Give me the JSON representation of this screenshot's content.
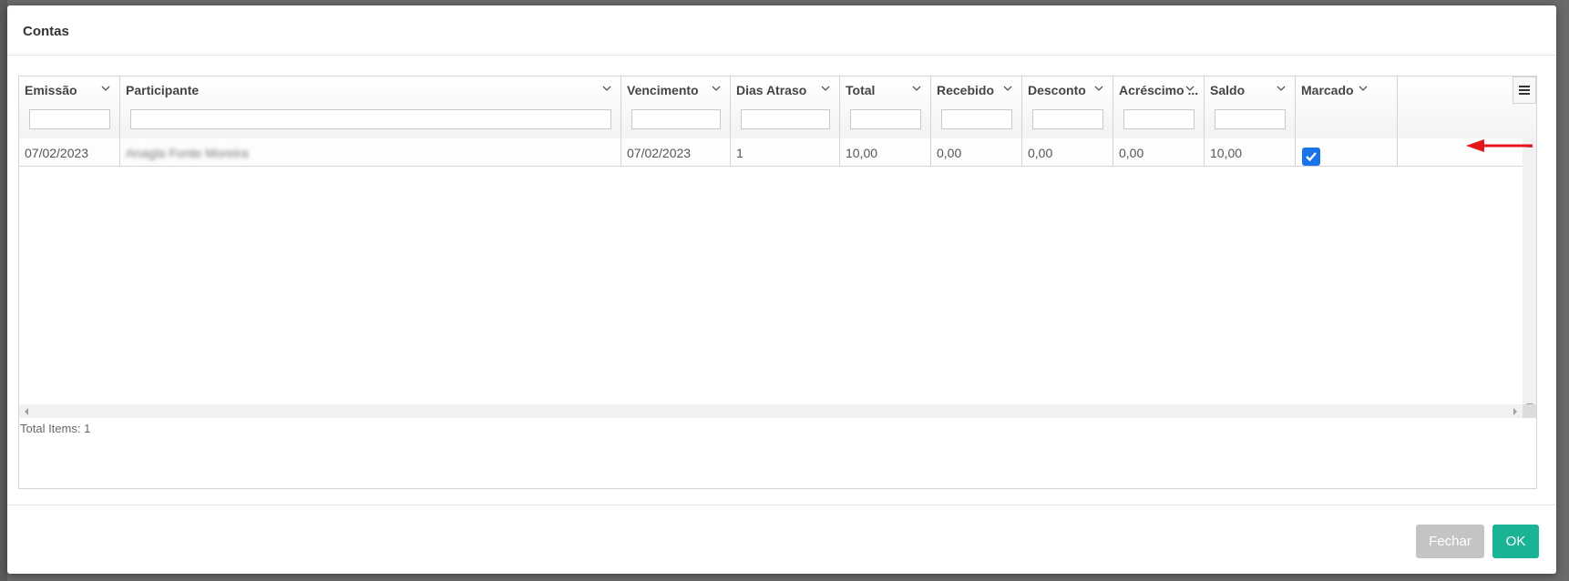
{
  "modal": {
    "title": "Contas"
  },
  "grid": {
    "columns": [
      {
        "key": "emissao",
        "label": "Emissão",
        "width": 111
      },
      {
        "key": "participante",
        "label": "Participante",
        "width": 550
      },
      {
        "key": "vencimento",
        "label": "Vencimento",
        "width": 120
      },
      {
        "key": "dias_atraso",
        "label": "Dias Atraso",
        "width": 120
      },
      {
        "key": "total",
        "label": "Total",
        "width": 100
      },
      {
        "key": "recebido",
        "label": "Recebido",
        "width": 100
      },
      {
        "key": "desconto",
        "label": "Desconto",
        "width": 100
      },
      {
        "key": "acrescimo",
        "label": "Acréscimo ...",
        "width": 100
      },
      {
        "key": "saldo",
        "label": "Saldo",
        "width": 100
      },
      {
        "key": "marcado",
        "label": "Marcado",
        "width": 112
      }
    ],
    "rows": [
      {
        "emissao": "07/02/2023",
        "participante": "Anagla Fonte Moreira",
        "vencimento": "07/02/2023",
        "dias_atraso": "1",
        "total": "10,00",
        "recebido": "0,00",
        "desconto": "0,00",
        "acrescimo": "0,00",
        "saldo": "10,00",
        "marcado": true
      }
    ],
    "footer": {
      "total_items": "Total Items: 1"
    }
  },
  "buttons": {
    "fechar": "Fechar",
    "ok": "OK"
  },
  "colors": {
    "checkbox": "#1a73e8",
    "ok_button": "#1ab394",
    "fechar_button": "#c4c4c4",
    "annotation_arrow": "#e8141e"
  }
}
